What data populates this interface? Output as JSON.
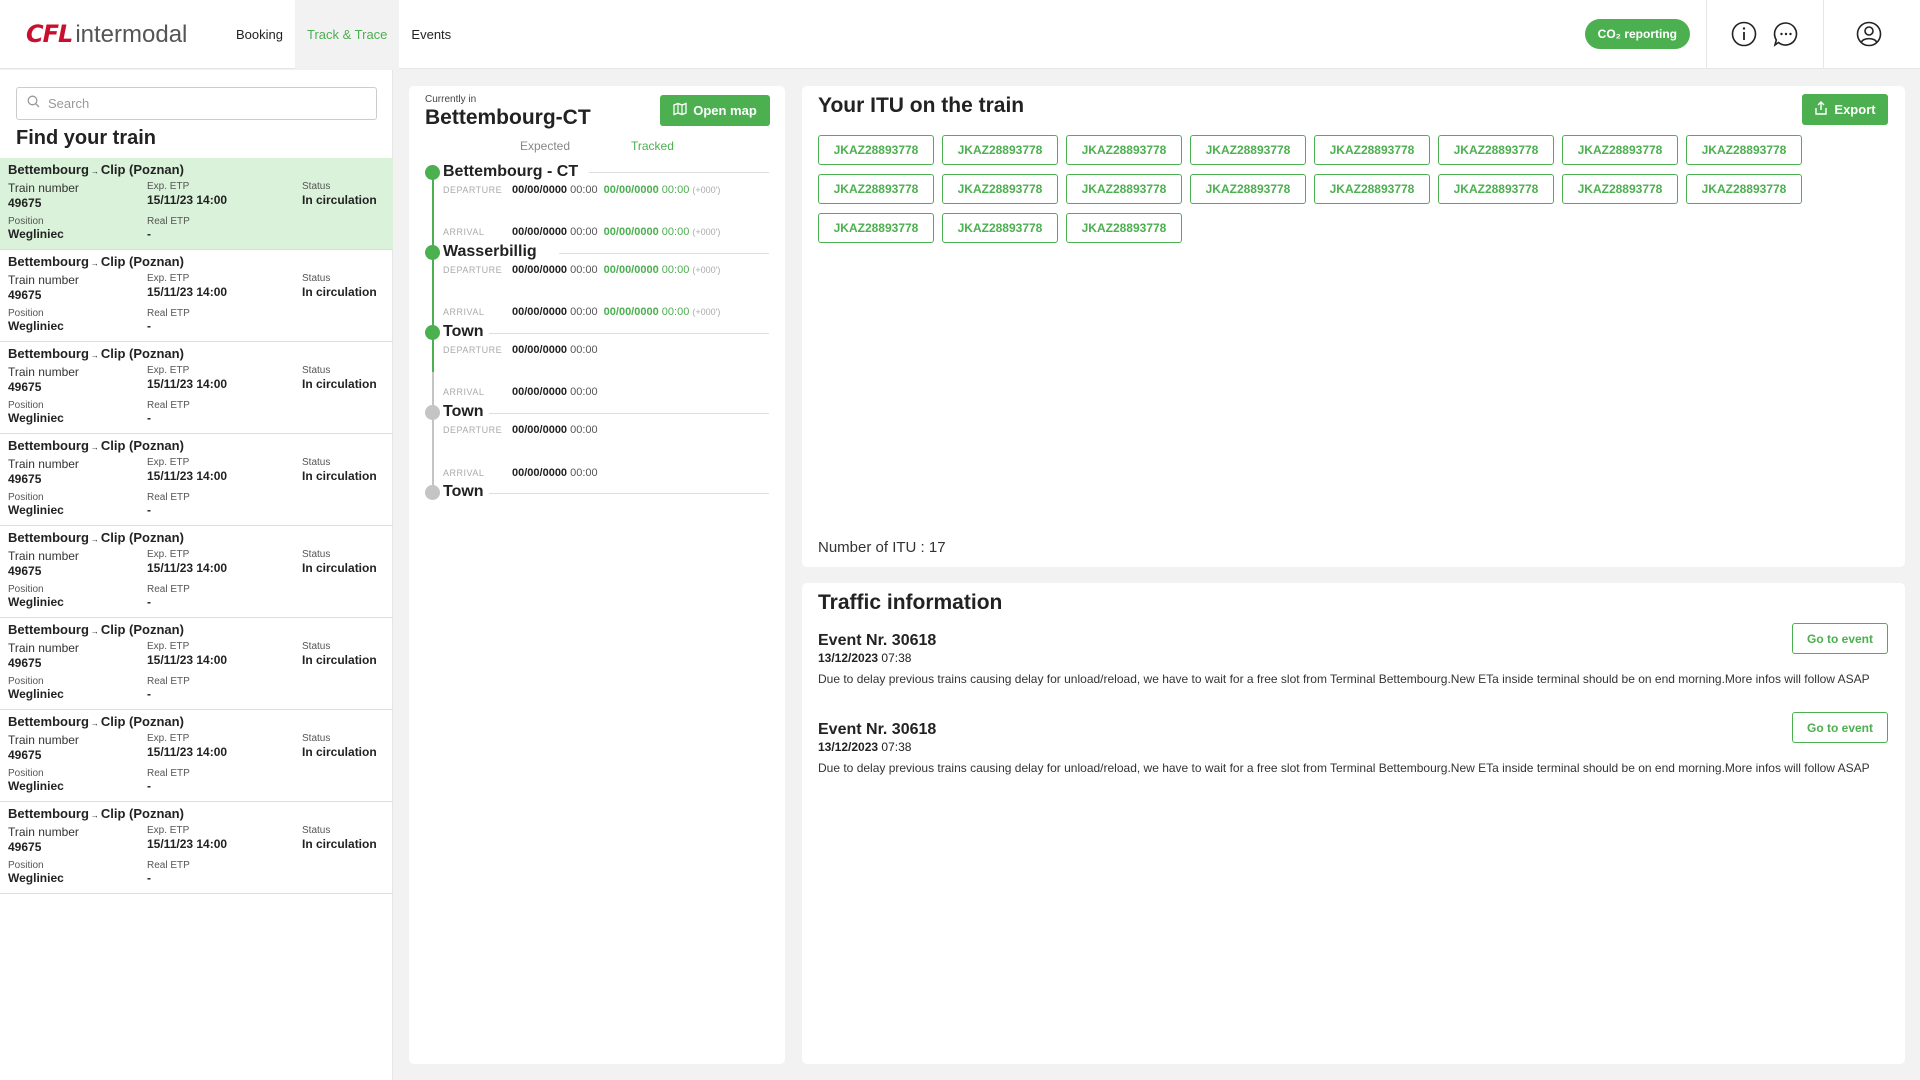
{
  "header": {
    "logo_brand": "CFL",
    "logo_product": "intermodal",
    "nav": [
      {
        "label": "Booking",
        "active": false
      },
      {
        "label": "Track & Trace",
        "active": true
      },
      {
        "label": "Events",
        "active": false
      }
    ],
    "co2_button": "CO₂ reporting",
    "icons": [
      "info-icon",
      "chat-icon",
      "account-icon"
    ]
  },
  "sidebar": {
    "search_placeholder": "Search",
    "title": "Find your train",
    "labels": {
      "train_number": "Train number",
      "exp_etp": "Exp. ETP",
      "status": "Status",
      "position": "Position",
      "real_etp": "Real ETP"
    },
    "trains": [
      {
        "from": "Bettembourg",
        "to": "Clip (Poznan)",
        "train_number": "49675",
        "exp_etp": "15/11/23 14:00",
        "status": "In circulation",
        "position": "Wegliniec",
        "real_etp": "-",
        "selected": true
      },
      {
        "from": "Bettembourg",
        "to": "Clip (Poznan)",
        "train_number": "49675",
        "exp_etp": "15/11/23 14:00",
        "status": "In circulation",
        "position": "Wegliniec",
        "real_etp": "-",
        "selected": false
      },
      {
        "from": "Bettembourg",
        "to": "Clip (Poznan)",
        "train_number": "49675",
        "exp_etp": "15/11/23 14:00",
        "status": "In circulation",
        "position": "Wegliniec",
        "real_etp": "-",
        "selected": false
      },
      {
        "from": "Bettembourg",
        "to": "Clip (Poznan)",
        "train_number": "49675",
        "exp_etp": "15/11/23 14:00",
        "status": "In circulation",
        "position": "Wegliniec",
        "real_etp": "-",
        "selected": false
      },
      {
        "from": "Bettembourg",
        "to": "Clip (Poznan)",
        "train_number": "49675",
        "exp_etp": "15/11/23 14:00",
        "status": "In circulation",
        "position": "Wegliniec",
        "real_etp": "-",
        "selected": false
      },
      {
        "from": "Bettembourg",
        "to": "Clip (Poznan)",
        "train_number": "49675",
        "exp_etp": "15/11/23 14:00",
        "status": "In circulation",
        "position": "Wegliniec",
        "real_etp": "-",
        "selected": false
      },
      {
        "from": "Bettembourg",
        "to": "Clip (Poznan)",
        "train_number": "49675",
        "exp_etp": "15/11/23 14:00",
        "status": "In circulation",
        "position": "Wegliniec",
        "real_etp": "-",
        "selected": false
      },
      {
        "from": "Bettembourg",
        "to": "Clip (Poznan)",
        "train_number": "49675",
        "exp_etp": "15/11/23 14:00",
        "status": "In circulation",
        "position": "Wegliniec",
        "real_etp": "-",
        "selected": false
      }
    ]
  },
  "journey": {
    "currently_in_label": "Currently in",
    "currently_in": "Bettembourg-CT",
    "open_map": "Open map",
    "legend_expected": "Expected",
    "legend_tracked": "Tracked",
    "departure_label": "DEPARTURE",
    "arrival_label": "ARRIVAL",
    "stops": [
      {
        "name": "Bettembourg - CT",
        "passed": true,
        "departure": {
          "date": "00/00/0000",
          "time": "00:00",
          "tracked_date": "00/00/0000",
          "tracked_time": "00:00",
          "delta": "(+000')"
        }
      },
      {
        "name": "Wasserbillig",
        "passed": true,
        "arrival": {
          "date": "00/00/0000",
          "time": "00:00",
          "tracked_date": "00/00/0000",
          "tracked_time": "00:00",
          "delta": "(+000')"
        },
        "departure": {
          "date": "00/00/0000",
          "time": "00:00",
          "tracked_date": "00/00/0000",
          "tracked_time": "00:00",
          "delta": "(+000')"
        }
      },
      {
        "name": "Town",
        "passed": true,
        "arrival": {
          "date": "00/00/0000",
          "time": "00:00",
          "tracked_date": "00/00/0000",
          "tracked_time": "00:00",
          "delta": "(+000')"
        },
        "departure": {
          "date": "00/00/0000",
          "time": "00:00"
        }
      },
      {
        "name": "Town",
        "passed": false,
        "arrival": {
          "date": "00/00/0000",
          "time": "00:00"
        },
        "departure": {
          "date": "00/00/0000",
          "time": "00:00"
        }
      },
      {
        "name": "Town",
        "passed": false,
        "arrival": {
          "date": "00/00/0000",
          "time": "00:00"
        }
      }
    ]
  },
  "itu": {
    "title": "Your ITU on the train",
    "export": "Export",
    "items": [
      "JKAZ28893778",
      "JKAZ28893778",
      "JKAZ28893778",
      "JKAZ28893778",
      "JKAZ28893778",
      "JKAZ28893778",
      "JKAZ28893778",
      "JKAZ28893778",
      "JKAZ28893778",
      "JKAZ28893778",
      "JKAZ28893778",
      "JKAZ28893778",
      "JKAZ28893778",
      "JKAZ28893778",
      "JKAZ28893778",
      "JKAZ28893778",
      "JKAZ28893778",
      "JKAZ28893778",
      "JKAZ28893778"
    ],
    "count_text": "Number of ITU : 17"
  },
  "traffic": {
    "title": "Traffic information",
    "events": [
      {
        "title": "Event Nr. 30618",
        "date": "13/12/2023",
        "time": "07:38",
        "text": "Due to delay previous trains causing delay for unload/reload, we have to wait for a free slot from Terminal Bettembourg.New ETa inside terminal should be on end morning.More infos will follow ASAP",
        "button": "Go to event"
      },
      {
        "title": "Event Nr. 30618",
        "date": "13/12/2023",
        "time": "07:38",
        "text": "Due to delay previous trains causing delay for unload/reload, we have to wait for a free slot from Terminal Bettembourg.New ETa inside terminal should be on end morning.More infos will follow ASAP",
        "button": "Go to event"
      }
    ]
  },
  "colors": {
    "accent": "#4caf50",
    "brand": "#c8102e",
    "selected_row": "#d9f2d9",
    "pending": "#c4c4c4"
  }
}
